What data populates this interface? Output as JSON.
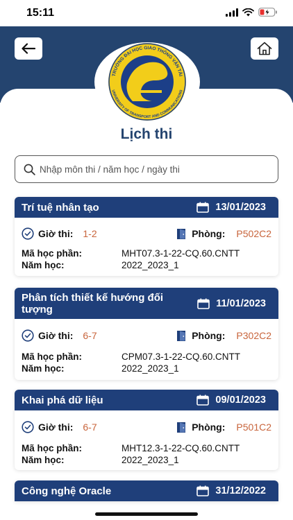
{
  "status": {
    "time": "15:11"
  },
  "logo": {
    "top_text": "TRƯỜNG ĐẠI HỌC GIAO THÔNG VẬN TẢI",
    "bottom_text": "UNIVERSITY OF TRANSPORT AND COMMUNICATIONS"
  },
  "page": {
    "title": "Lịch thi"
  },
  "search": {
    "placeholder": "Nhập môn thi / năm học / ngày thi"
  },
  "labels": {
    "time": "Giờ thi:",
    "room": "Phòng:",
    "course_code": "Mã học phần:",
    "school_year": "Năm học:"
  },
  "colors": {
    "header": "#24446f",
    "card_header": "#1f3f7a",
    "accent": "#c8643b"
  },
  "exams": [
    {
      "title": "Trí tuệ nhân tạo",
      "date": "13/01/2023",
      "time": "1-2",
      "room": "P502C2",
      "code": "MHT07.3-1-22-CQ.60.CNTT",
      "year": "2022_2023_1"
    },
    {
      "title": "Phân tích thiết kế hướng đối tượng",
      "date": "11/01/2023",
      "time": "6-7",
      "room": "P302C2",
      "code": "CPM07.3-1-22-CQ.60.CNTT",
      "year": "2022_2023_1"
    },
    {
      "title": "Khai phá dữ liệu",
      "date": "09/01/2023",
      "time": "6-7",
      "room": "P501C2",
      "code": "MHT12.3-1-22-CQ.60.CNTT",
      "year": "2022_2023_1"
    },
    {
      "title": "Công nghệ Oracle",
      "date": "31/12/2022"
    }
  ]
}
